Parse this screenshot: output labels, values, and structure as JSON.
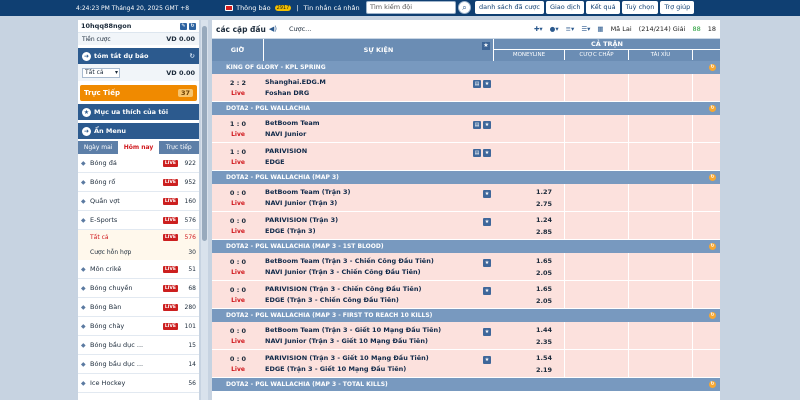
{
  "topbar": {
    "datetime": "4:24:23 PM Tháng4 20, 2025 GMT +8",
    "notice_label": "Thông báo",
    "notice_count": "2917",
    "separator": "|",
    "messages_label": "Tin nhắn cá nhân",
    "search_placeholder": "Tìm kiếm đội",
    "nav": [
      "danh sách đã cược",
      "Giao dịch",
      "Kết quả",
      "Tuỳ chọn",
      "Trợ giúp"
    ]
  },
  "sidebar": {
    "username": "10hqq88ngon",
    "credit_label": "Tiền cược",
    "credit_value": "VD  0.00",
    "summary_title": "tóm tắt dự báo",
    "filter_value": "Tất cả",
    "summary_value": "VD 0.00",
    "live_label": "Trực Tiếp",
    "live_count": "37",
    "favorites_title": "Mục ưa thích của tôi",
    "menu_title": "Ẩn Menu",
    "tabs": [
      "Ngày mai",
      "Hôm nay",
      "Trực tiếp"
    ],
    "live_badge": "LIVE",
    "sports": [
      {
        "name": "Bóng đá",
        "count": "922",
        "live": true
      },
      {
        "name": "Bóng rổ",
        "count": "952",
        "live": true
      },
      {
        "name": "Quần vợt",
        "count": "160",
        "live": true
      },
      {
        "name": "E-Sports",
        "count": "576",
        "live": true
      }
    ],
    "esports_sub": [
      {
        "name": "Tất cả",
        "count": "576",
        "live": true,
        "active": true
      },
      {
        "name": "Cược hỗn hợp",
        "count": "30",
        "live": false,
        "active": false
      }
    ],
    "sports2": [
      {
        "name": "Môn crikê",
        "count": "51",
        "live": true
      },
      {
        "name": "Bóng chuyền",
        "count": "68",
        "live": true
      },
      {
        "name": "Bóng Bàn",
        "count": "280",
        "live": true
      },
      {
        "name": "Bóng chày",
        "count": "101",
        "live": true
      },
      {
        "name": "Bóng bầu dục ...",
        "count": "15",
        "live": false
      },
      {
        "name": "Bóng bầu dục ...",
        "count": "14",
        "live": false
      },
      {
        "name": "Ice Hockey",
        "count": "56",
        "live": false
      }
    ]
  },
  "main": {
    "title": "các cặp đấu",
    "league_filter": "Cược...",
    "sort_label": "Mã Lai",
    "match_count": "(214/214) Giải",
    "stat1": "88",
    "stat2": "18",
    "col_time": "GIỜ",
    "col_event": "SỰ KIỆN",
    "col_full": "CẢ TRẬN",
    "col_moneyline": "MONEYLINE",
    "col_handicap": "CƯỢC CHẤP",
    "col_overunder": "TÀI XỈU",
    "live_text": "Live",
    "leagues": [
      {
        "name": "KING OF GLORY - KPL SPRING",
        "matches": [
          {
            "score": "2 : 2",
            "home": "Shanghai.EDG.M",
            "away": "Foshan DRG",
            "odds_home": "",
            "odds_away": ""
          }
        ]
      },
      {
        "name": "DOTA2 - PGL WALLACHIA",
        "matches": [
          {
            "score": "1 : 0",
            "home": "BetBoom Team",
            "away": "NAVI Junior",
            "odds_home": "",
            "odds_away": ""
          },
          {
            "score": "1 : 0",
            "home": "PARIVISION",
            "away": "EDGE",
            "odds_home": "",
            "odds_away": ""
          }
        ]
      },
      {
        "name": "DOTA2 - PGL WALLACHIA (MAP 3)",
        "matches": [
          {
            "score": "0 : 0",
            "home": "BetBoom Team (Trận 3)",
            "away": "NAVI Junior (Trận 3)",
            "odds_home": "1.27",
            "odds_away": "2.75"
          },
          {
            "score": "0 : 0",
            "home": "PARIVISION (Trận 3)",
            "away": "EDGE (Trận 3)",
            "odds_home": "1.24",
            "odds_away": "2.85"
          }
        ]
      },
      {
        "name": "DOTA2 - PGL WALLACHIA (MAP 3 - 1ST BLOOD)",
        "matches": [
          {
            "score": "0 : 0",
            "home": "BetBoom Team (Trận 3 - Chiến Công Đầu Tiên)",
            "away": "NAVI Junior (Trận 3 - Chiến Công Đầu Tiên)",
            "odds_home": "1.65",
            "odds_away": "2.05"
          },
          {
            "score": "0 : 0",
            "home": "PARIVISION (Trận 3 - Chiến Công Đầu Tiên)",
            "away": "EDGE (Trận 3 - Chiến Công Đầu Tiên)",
            "odds_home": "1.65",
            "odds_away": "2.05"
          }
        ]
      },
      {
        "name": "DOTA2 - PGL WALLACHIA (MAP 3 - FIRST TO REACH 10 KILLS)",
        "matches": [
          {
            "score": "0 : 0",
            "home": "BetBoom Team (Trận 3 - Giết 10 Mạng Đầu Tiên)",
            "away": "NAVI Junior (Trận 3 - Giết 10 Mạng Đầu Tiên)",
            "odds_home": "1.44",
            "odds_away": "2.35"
          },
          {
            "score": "0 : 0",
            "home": "PARIVISION (Trận 3 - Giết 10 Mạng Đầu Tiên)",
            "away": "EDGE (Trận 3 - Giết 10 Mạng Đầu Tiên)",
            "odds_home": "1.54",
            "odds_away": "2.19"
          }
        ]
      },
      {
        "name": "DOTA2 - PGL WALLACHIA (MAP 3 - TOTAL KILLS)",
        "matches": []
      }
    ]
  }
}
